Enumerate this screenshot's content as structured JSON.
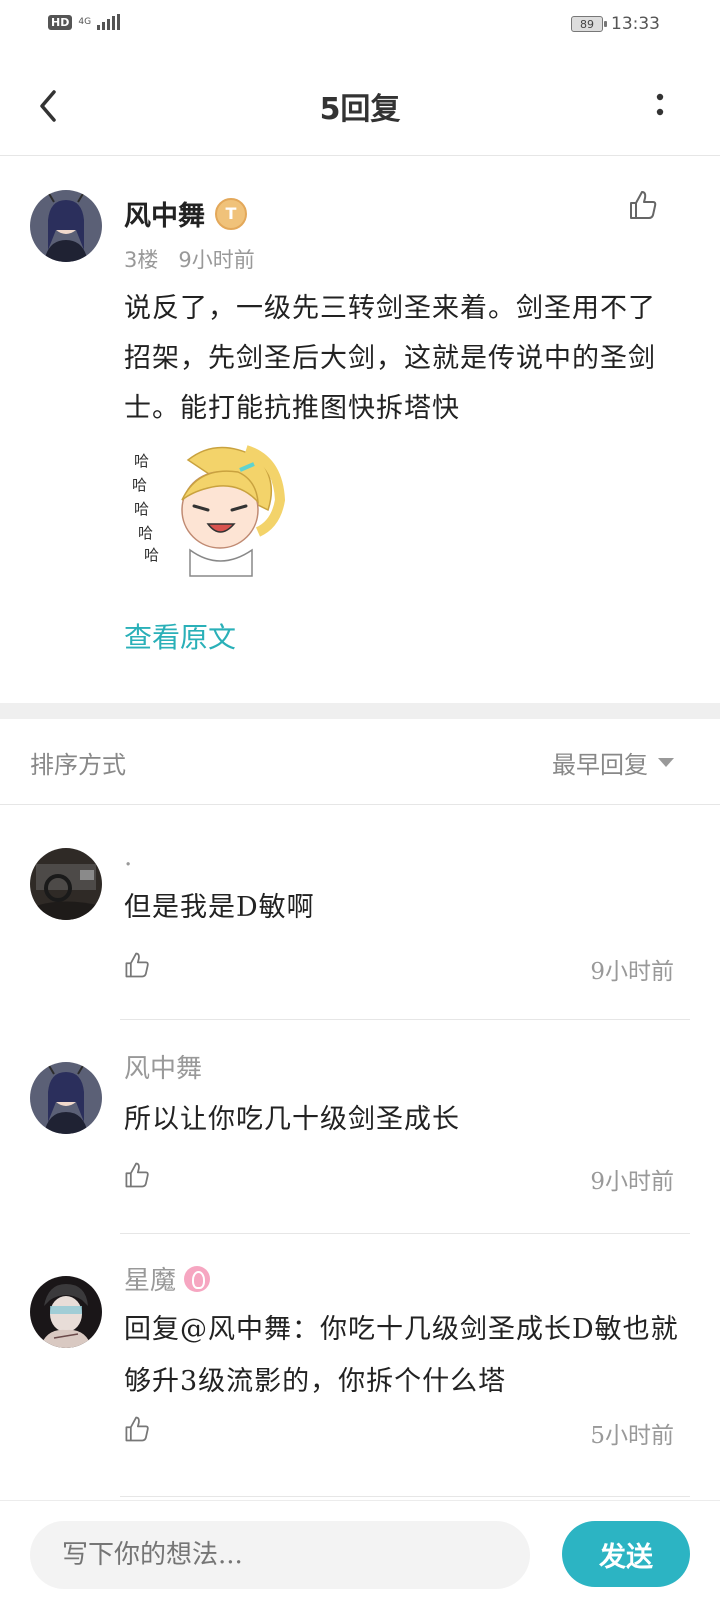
{
  "status_bar": {
    "hd": "HD",
    "network": "4G",
    "battery": "89",
    "time": "13:33"
  },
  "nav": {
    "title": "5回复",
    "back_icon": "chevron-left-icon",
    "more_icon": "more-vertical-icon"
  },
  "post": {
    "author": "风中舞",
    "level_badge": "T",
    "floor": "3楼",
    "time": "9小时前",
    "body": "说反了，一级先三转剑圣来着。剑圣用不了招架，先剑圣后大剑，这就是传说中的圣剑士。能打能抗推图快拆塔快",
    "view_original": "查看原文"
  },
  "sort": {
    "label": "排序方式",
    "selected": "最早回复"
  },
  "replies": [
    {
      "author": ".",
      "text": "但是我是D敏啊",
      "time": "9小时前"
    },
    {
      "author": "风中舞",
      "text": "所以让你吃几十级剑圣成长",
      "time": "9小时前"
    },
    {
      "author": "星魔",
      "text": "回复@风中舞：你吃十几级剑圣成长D敏也就够升3级流影的，你拆个什么塔",
      "time": "5小时前"
    }
  ],
  "composer": {
    "placeholder": "写下你的想法...",
    "send_label": "发送"
  },
  "colors": {
    "accent": "#2cb4c3",
    "link": "#2ab0b8"
  }
}
